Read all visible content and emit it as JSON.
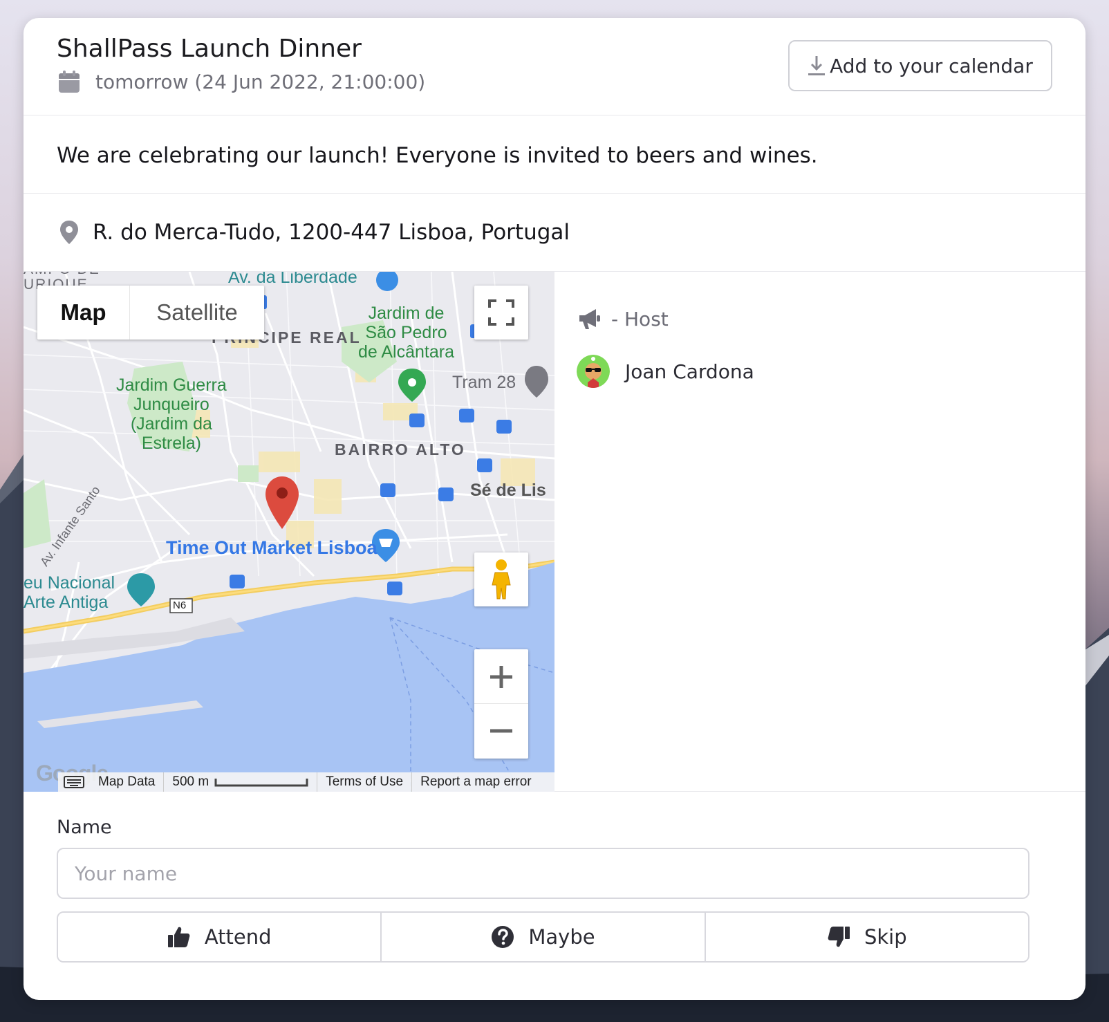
{
  "event": {
    "title": "ShallPass Launch Dinner",
    "date": "tomorrow (24 Jun 2022, 21:00:00)",
    "calendar_button": "Add to your calendar",
    "description": "We are celebrating our launch! Everyone is invited to beers and wines.",
    "address": "R. do Merca-Tudo, 1200-447 Lisboa, Portugal"
  },
  "map": {
    "type_map": "Map",
    "type_satellite": "Satellite",
    "labels": {
      "liberdade": "Av. da Liberdade",
      "top_left": "AMPO DE\nURIQUE",
      "principe_real": "PRÍNCIPE REAL",
      "jardim_sao_pedro": "Jardim de\nSão Pedro\nde Alcântara",
      "jardim_estrela": "Jardim Guerra\nJunqueiro\n(Jardim da\nEstrela)",
      "tram": "Tram 28",
      "bairro_alto": "BAIRRO ALTO",
      "se": "Sé de Lis",
      "infante": "Av. Infante Santo",
      "time_out": "Time Out Market Lisboa",
      "museu": "eu Nacional\nArte Antiga",
      "road": "N6"
    },
    "attribution": {
      "google": "Google",
      "map_data": "Map Data",
      "scale": "500 m",
      "terms": "Terms of Use",
      "report": "Report a map error"
    }
  },
  "attendees": {
    "host_label": "- Host",
    "people": [
      {
        "name": "Joan Cardona"
      }
    ]
  },
  "form": {
    "name_label": "Name",
    "name_placeholder": "Your name",
    "name_value": "",
    "attend": "Attend",
    "maybe": "Maybe",
    "skip": "Skip"
  },
  "colors": {
    "map_water": "#a8c4f4",
    "map_land": "#e9e9ee",
    "map_green": "#cde9c8",
    "marker": "#dc4b3e"
  }
}
